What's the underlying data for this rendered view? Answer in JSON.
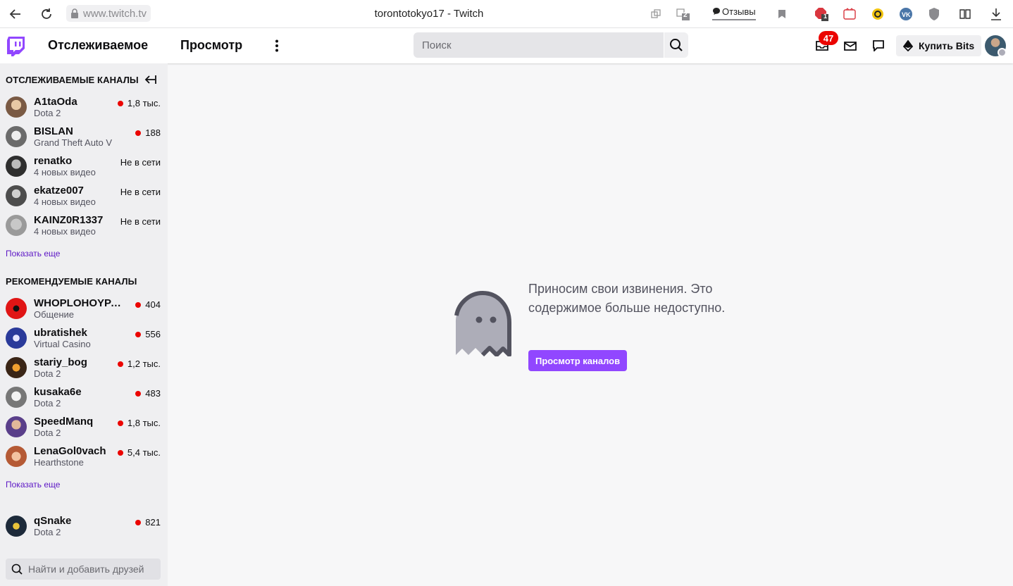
{
  "browser": {
    "url": "www.twitch.tv",
    "window_title": "torontotokyo17 - Twitch",
    "feedback_label": "Отзывы",
    "tab_badge": "2",
    "ext_badge": "1"
  },
  "nav": {
    "following": "Отслеживаемое",
    "browse": "Просмотр",
    "search_placeholder": "Поиск",
    "notifications_count": "47",
    "buy_bits": "Купить Bits"
  },
  "sidebar": {
    "followed_title": "ОТСЛЕЖИВАЕМЫЕ КАНАЛЫ",
    "followed": [
      {
        "name": "A1taOda",
        "game": "Dota 2",
        "viewers": "1,8 тыс.",
        "live": true
      },
      {
        "name": "BISLAN",
        "game": "Grand Theft Auto V",
        "viewers": "188",
        "live": true
      },
      {
        "name": "renatko",
        "game": "4 новых видео",
        "viewers": "Не в сети",
        "live": false
      },
      {
        "name": "ekatze007",
        "game": "4 новых видео",
        "viewers": "Не в сети",
        "live": false
      },
      {
        "name": "KAINZ0R1337",
        "game": "4 новых видео",
        "viewers": "Не в сети",
        "live": false
      }
    ],
    "show_more": "Показать еще",
    "recommended_title": "РЕКОМЕНДУЕМЫЕ КАНАЛЫ",
    "recommended": [
      {
        "name": "WHOPLOHOYPARNISHKA",
        "game": "Общение",
        "viewers": "404"
      },
      {
        "name": "ubratishek",
        "game": "Virtual Casino",
        "viewers": "556"
      },
      {
        "name": "stariy_bog",
        "game": "Dota 2",
        "viewers": "1,2 тыс."
      },
      {
        "name": "kusaka6e",
        "game": "Dota 2",
        "viewers": "483"
      },
      {
        "name": "SpeedManq",
        "game": "Dota 2",
        "viewers": "1,8 тыс."
      },
      {
        "name": "LenaGol0vach",
        "game": "Hearthstone",
        "viewers": "5,4 тыс."
      }
    ],
    "show_more_2": "Показать еще",
    "extra": [
      {
        "name": "qSnake",
        "game": "Dota 2",
        "viewers": "821"
      }
    ],
    "friends_placeholder": "Найти и добавить друзей"
  },
  "main": {
    "message": "Приносим свои извинения. Это содержимое больше недоступно.",
    "button": "Просмотр каналов"
  },
  "colors": {
    "brand": "#9147ff",
    "live": "#eb0400"
  }
}
